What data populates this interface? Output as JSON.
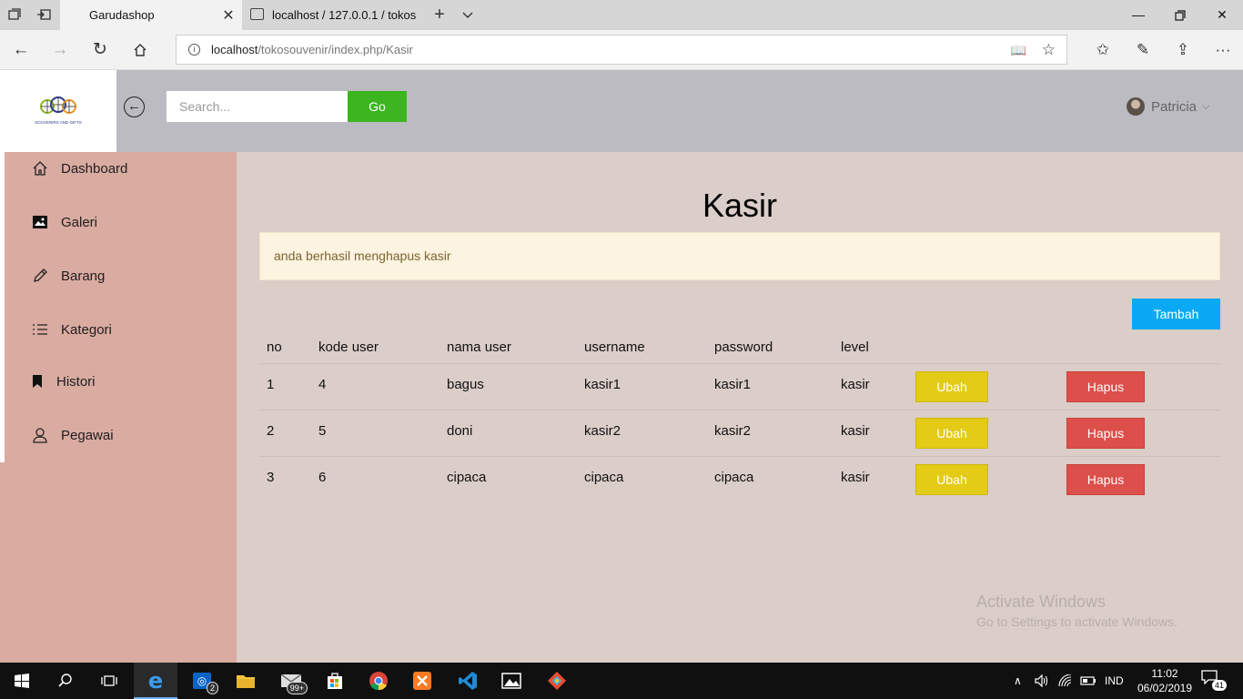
{
  "browser": {
    "tabs": [
      {
        "title": "Garudashop",
        "active": true
      },
      {
        "title": "localhost / 127.0.0.1 / tokos",
        "active": false
      }
    ],
    "url_host": "localhost",
    "url_path": "/tokosouvenir/index.php/Kasir"
  },
  "header": {
    "logo_alt": "SOUVENIRS AND GIFTS",
    "search_placeholder": "Search...",
    "go_label": "Go",
    "user_name": "Patricia"
  },
  "sidebar": {
    "items": [
      {
        "label": "Dashboard",
        "icon": "home-icon"
      },
      {
        "label": "Galeri",
        "icon": "image-icon"
      },
      {
        "label": "Barang",
        "icon": "pencil-icon"
      },
      {
        "label": "Kategori",
        "icon": "list-icon"
      },
      {
        "label": "Histori",
        "icon": "bookmark-icon"
      },
      {
        "label": "Pegawai",
        "icon": "user-icon"
      }
    ]
  },
  "main": {
    "title": "Kasir",
    "alert": "anda berhasil menghapus kasir",
    "add_label": "Tambah",
    "table": {
      "headers": [
        "no",
        "kode user",
        "nama user",
        "username",
        "password",
        "level"
      ],
      "rows": [
        {
          "no": "1",
          "kode": "4",
          "nama": "bagus",
          "username": "kasir1",
          "password": "kasir1",
          "level": "kasir"
        },
        {
          "no": "2",
          "kode": "5",
          "nama": "doni",
          "username": "kasir2",
          "password": "kasir2",
          "level": "kasir"
        },
        {
          "no": "3",
          "kode": "6",
          "nama": "cipaca",
          "username": "cipaca",
          "password": "cipaca",
          "level": "kasir"
        }
      ],
      "edit_label": "Ubah",
      "delete_label": "Hapus"
    }
  },
  "watermark": {
    "line1": "Activate Windows",
    "line2": "Go to Settings to activate Windows."
  },
  "taskbar": {
    "mail_badge": "2",
    "store_badge": "99+",
    "lang": "IND",
    "time": "11:02",
    "date": "06/02/2019",
    "notif_count": "41"
  },
  "colors": {
    "header_bg": "#bcbbc1",
    "sidebar_bg": "#d9aba1",
    "main_bg": "#dbcdc8",
    "go_green": "#3cb521",
    "tambah_blue": "#0aa9f3",
    "ubah_yellow": "#e3cb16",
    "hapus_red": "#dd4f4a"
  }
}
